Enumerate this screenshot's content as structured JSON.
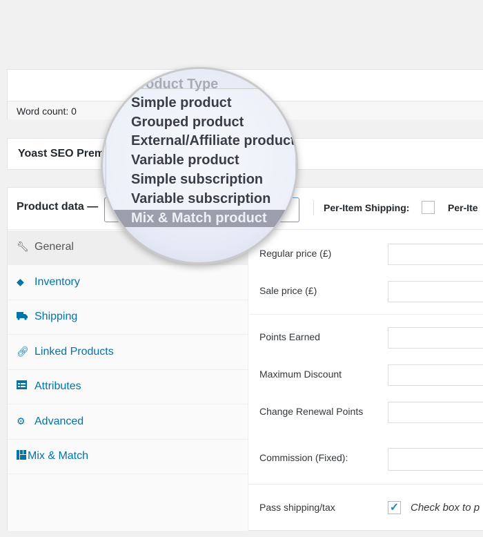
{
  "editor": {
    "word_count": "Word count: 0"
  },
  "yoast": {
    "title": "Yoast SEO Premium"
  },
  "product_data": {
    "title": "Product data —",
    "per_item_shipping": "Per-Item Shipping:",
    "per_item_more": "Per-Ite",
    "tabs": [
      {
        "label": "General",
        "icon": "wrench-icon",
        "active": true
      },
      {
        "label": "Inventory",
        "icon": "tag-icon"
      },
      {
        "label": "Shipping",
        "icon": "truck-icon"
      },
      {
        "label": "Linked Products",
        "icon": "link-icon"
      },
      {
        "label": "Attributes",
        "icon": "list-icon"
      },
      {
        "label": "Advanced",
        "icon": "gear-icon"
      },
      {
        "label": "Mix & Match",
        "icon": "grid-icon"
      }
    ],
    "fields": [
      {
        "label": "Regular price (£)"
      },
      {
        "label": "Sale price (£)"
      },
      {
        "label": "Points Earned"
      },
      {
        "label": "Maximum Discount"
      },
      {
        "label": "Change Renewal Points"
      },
      {
        "label": "Commission (Fixed):"
      }
    ],
    "pass_shipping": {
      "label": "Pass shipping/tax",
      "checked": true,
      "description": "Check box to p"
    }
  },
  "dropdown": {
    "header": "Product Type",
    "options": [
      "Simple product",
      "Grouped product",
      "External/Affiliate product",
      "Variable product",
      "Simple subscription",
      "Variable subscription",
      "Mix & Match product"
    ],
    "selected": "Mix & Match product"
  },
  "colors": {
    "link": "#0073aa",
    "focus": "#5b9dd9",
    "highlight": "#9c9eac"
  }
}
